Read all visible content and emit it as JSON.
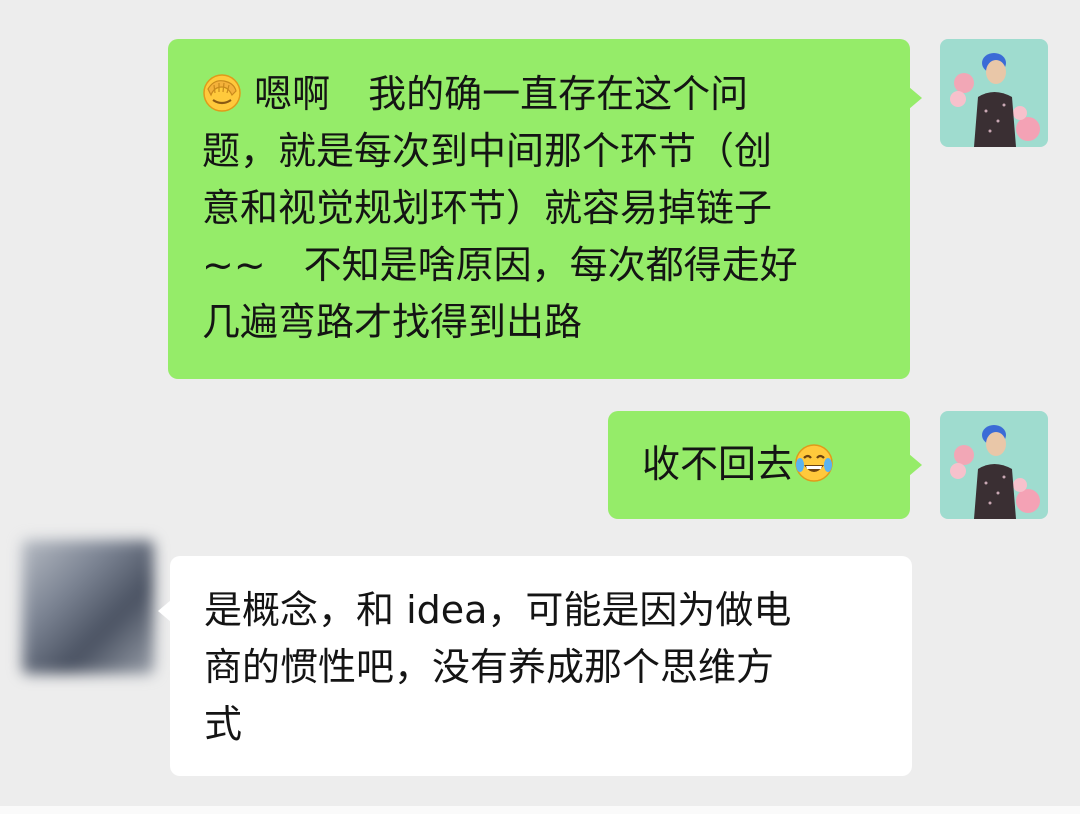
{
  "conversation": {
    "messages": [
      {
        "sender": "self",
        "emoji_name": "face-palm-emoji",
        "lines": [
          "嗯啊　我的确一直存在这个问",
          "题，就是每次到中间那个环节（创",
          "意和视觉规划环节）就容易掉链子",
          "~~　不知是啥原因，每次都得走好",
          "几遍弯路才找得到出路"
        ]
      },
      {
        "sender": "self",
        "emoji_name": "tears-of-joy-emoji",
        "lines": [
          "收不回去"
        ]
      },
      {
        "sender": "other",
        "lines": [
          "是概念，和 idea，可能是因为做电",
          "商的惯性吧，没有养成那个思维方",
          "式"
        ]
      }
    ]
  },
  "colors": {
    "background": "#ededed",
    "self_bubble": "#95ec69",
    "other_bubble": "#ffffff",
    "text": "#141414"
  }
}
